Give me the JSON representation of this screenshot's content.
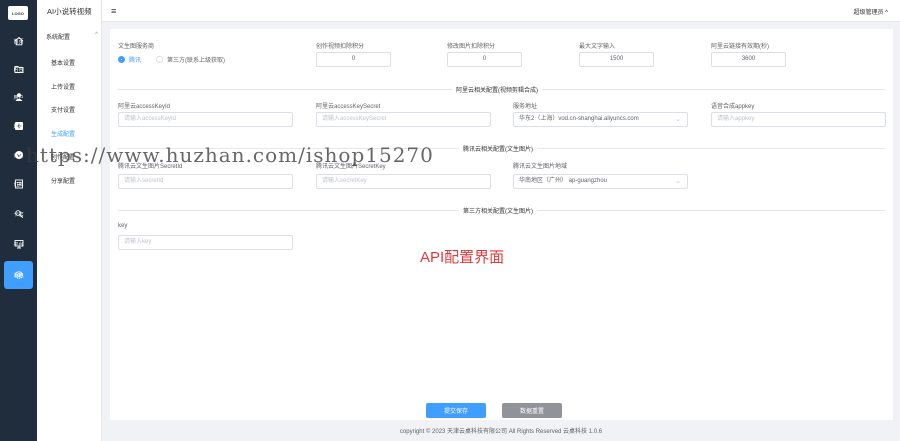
{
  "rail": {
    "logo_text": "LOGO",
    "items": [
      {
        "label": "首页",
        "icon": "home-icon"
      },
      {
        "label": "内容",
        "icon": "folder-icon"
      },
      {
        "label": "用户",
        "icon": "user-icon"
      },
      {
        "label": "题材",
        "icon": "plus-square-icon"
      },
      {
        "label": "会员",
        "icon": "vip-icon"
      },
      {
        "label": "订单",
        "icon": "order-icon"
      },
      {
        "label": "卡密",
        "icon": "key-icon"
      },
      {
        "label": "平台",
        "icon": "monitor-icon"
      },
      {
        "label": "系统",
        "icon": "gear-icon"
      }
    ]
  },
  "sidebar": {
    "app_title": "AI小说转视频",
    "group": "系统配置",
    "items": [
      "基本设置",
      "上传设置",
      "支付设置",
      "生成配置",
      "创作配置",
      "分享配置"
    ]
  },
  "header": {
    "admin_label": "超级管理员"
  },
  "form": {
    "row1": {
      "provider_label": "文生图服务商",
      "option_tencent": "腾讯",
      "option_third": "第三方(联系上级获取)",
      "video_points_label": "创作视频扣除积分",
      "video_points_value": "0",
      "image_points_label": "修改图片扣除积分",
      "image_points_value": "0",
      "max_text_label": "最大文字输入",
      "max_text_value": "1500",
      "link_expiry_label": "阿里云链接有效期(秒)",
      "link_expiry_value": "3600"
    },
    "aliyun_divider": "阿里云相关配置(视频剪辑合成)",
    "aliyun": {
      "key_id_label": "阿里云accessKeyId",
      "key_id_placeholder": "请输入accessKeyId",
      "key_secret_label": "阿里云accessKeySecret",
      "key_secret_placeholder": "请输入accessKeySecret",
      "service_label": "服务地址",
      "service_value": "华东2（上海）vod.cn-shanghai.aliyuncs.com",
      "appkey_label": "语音合成appkey",
      "appkey_placeholder": "请输入appkey"
    },
    "tencent_divider": "腾讯云相关配置(文生图片)",
    "tencent": {
      "secret_id_label": "腾讯云文生图片SecretId",
      "secret_id_placeholder": "请输入secretId",
      "secret_key_label": "腾讯云文生图片SecretKey",
      "secret_key_placeholder": "请输入secretKey",
      "region_label": "腾讯云文生图片地域",
      "region_value": "华南地区（广州）  ap-guangzhou"
    },
    "third_divider": "第三方相关配置(文生图片)",
    "third": {
      "key_label": "key",
      "key_placeholder": "请输入key"
    }
  },
  "annotation": "API配置界面",
  "buttons": {
    "submit": "提交保存",
    "restore": "数据重置"
  },
  "footer": "copyright © 2023  天津云桌科技有限公司 All Rights Reserved  云桌科技 1.0.6",
  "watermark": "https://www.huzhan.com/ishop15270",
  "colors": {
    "primary": "#409eff",
    "rail_bg": "#1f2d3d",
    "annotation": "#e23a3a"
  }
}
